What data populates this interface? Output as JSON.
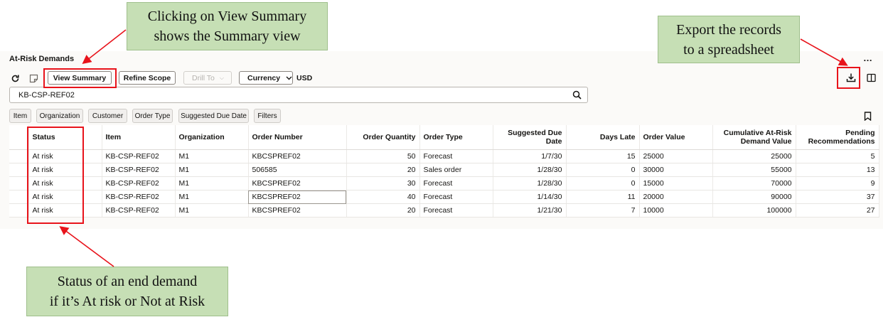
{
  "page": {
    "title": "At-Risk Demands",
    "more_label": "…"
  },
  "toolbar": {
    "view_summary": "View Summary",
    "refine_scope": "Refine Scope",
    "drill_to": "Drill To",
    "currency": "Currency",
    "currency_value": "USD",
    "icons": [
      "refresh-icon",
      "note-icon",
      "export-icon",
      "column-panel-icon",
      "search-icon",
      "bookmark-icon"
    ]
  },
  "search": {
    "value": "KB-CSP-REF02"
  },
  "filters": {
    "item": "Item",
    "organization": "Organization",
    "customer": "Customer",
    "order_type": "Order Type",
    "suggested_due_date": "Suggested Due Date",
    "filters": "Filters"
  },
  "table": {
    "headers": [
      "Status",
      "Item",
      "Organization",
      "Order Number",
      "Order Quantity",
      "Order Type",
      "Suggested Due Date",
      "Days Late",
      "Order Value",
      "Cumulative At-Risk Demand Value",
      "Pending Recommendations"
    ],
    "rows": [
      [
        "At risk",
        "KB-CSP-REF02",
        "M1",
        "KBCSPREF02",
        "50",
        "Forecast",
        "1/7/30",
        "15",
        "25000",
        "25000",
        "5"
      ],
      [
        "At risk",
        "KB-CSP-REF02",
        "M1",
        "506585",
        "20",
        "Sales order",
        "1/28/30",
        "0",
        "30000",
        "55000",
        "13"
      ],
      [
        "At risk",
        "KB-CSP-REF02",
        "M1",
        "KBCSPREF02",
        "30",
        "Forecast",
        "1/28/30",
        "0",
        "15000",
        "70000",
        "9"
      ],
      [
        "At risk",
        "KB-CSP-REF02",
        "M1",
        "KBCSPREF02",
        "40",
        "Forecast",
        "1/14/30",
        "11",
        "20000",
        "90000",
        "37"
      ],
      [
        "At risk",
        "KB-CSP-REF02",
        "M1",
        "KBCSPREF02",
        "20",
        "Forecast",
        "1/21/30",
        "7",
        "10000",
        "100000",
        "27"
      ]
    ]
  },
  "callouts": {
    "view_summary_l1": "Clicking on View Summary",
    "view_summary_l2": "shows the Summary view",
    "export_l1": "Export the records",
    "export_l2": "to a spreadsheet",
    "status_l1": "Status of an end demand",
    "status_l2": "if it’s At risk or Not at Risk"
  },
  "colors": {
    "highlight": "#e8131b",
    "callout_bg": "#c6dfb5"
  }
}
